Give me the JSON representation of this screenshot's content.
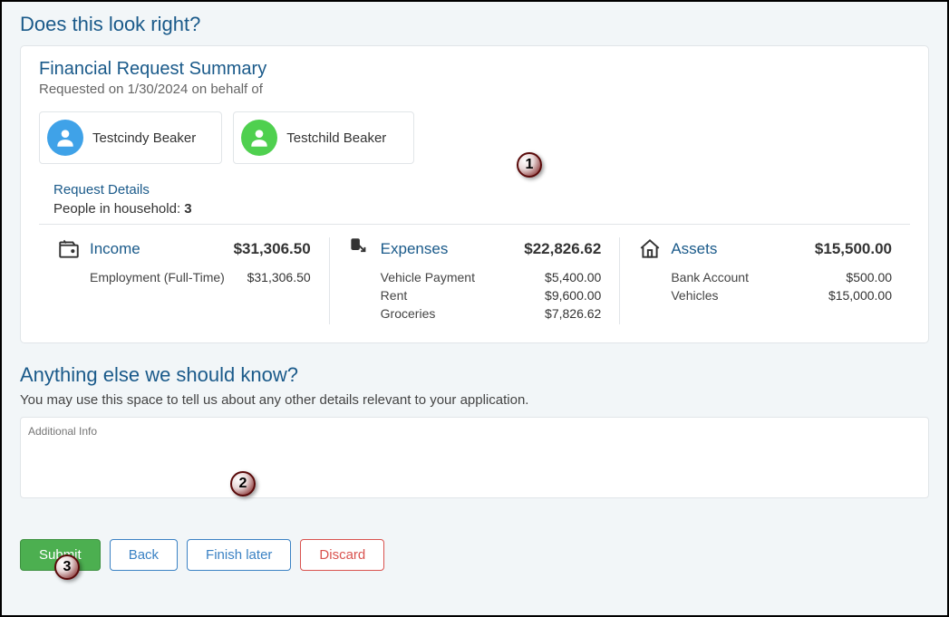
{
  "page_title": "Does this look right?",
  "summary": {
    "title": "Financial Request Summary",
    "subtitle": "Requested on 1/30/2024 on behalf of",
    "people": [
      {
        "name": "Testcindy Beaker",
        "avatar_color": "blue"
      },
      {
        "name": "Testchild Beaker",
        "avatar_color": "green"
      }
    ],
    "request_details_label": "Request Details",
    "household_label": "People in household:",
    "household_count": "3",
    "columns": [
      {
        "title": "Income",
        "total": "$31,306.50",
        "items": [
          {
            "label": "Employment (Full-Time)",
            "value": "$31,306.50"
          }
        ]
      },
      {
        "title": "Expenses",
        "total": "$22,826.62",
        "items": [
          {
            "label": "Vehicle Payment",
            "value": "$5,400.00"
          },
          {
            "label": "Rent",
            "value": "$9,600.00"
          },
          {
            "label": "Groceries",
            "value": "$7,826.62"
          }
        ]
      },
      {
        "title": "Assets",
        "total": "$15,500.00",
        "items": [
          {
            "label": "Bank Account",
            "value": "$500.00"
          },
          {
            "label": "Vehicles",
            "value": "$15,000.00"
          }
        ]
      }
    ]
  },
  "additional": {
    "title": "Anything else we should know?",
    "desc": "You may use this space to tell us about any other details relevant to your application.",
    "placeholder": "Additional Info"
  },
  "buttons": {
    "submit": "Submit",
    "back": "Back",
    "finish": "Finish later",
    "discard": "Discard"
  },
  "callouts": {
    "c1": "1",
    "c2": "2",
    "c3": "3"
  }
}
